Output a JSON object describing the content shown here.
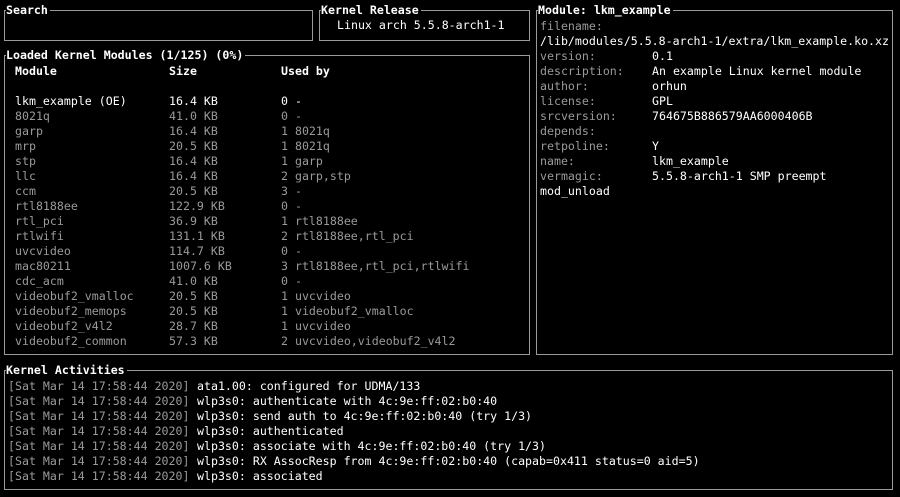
{
  "search": {
    "title": "Search",
    "value": ""
  },
  "kernel_release": {
    "title": "Kernel Release",
    "value": "Linux arch 5.5.8-arch1-1"
  },
  "modules": {
    "title": "Loaded Kernel Modules (1/125) (0%)",
    "columns": [
      "Module",
      "Size",
      "Used by"
    ],
    "rows": [
      {
        "name": "lkm_example (OE)",
        "size": "16.4 KB",
        "used": "0 -"
      },
      {
        "name": "8021q",
        "size": "41.0 KB",
        "used": "0 -"
      },
      {
        "name": "garp",
        "size": "16.4 KB",
        "used": "1 8021q"
      },
      {
        "name": "mrp",
        "size": "20.5 KB",
        "used": "1 8021q"
      },
      {
        "name": "stp",
        "size": "16.4 KB",
        "used": "1 garp"
      },
      {
        "name": "llc",
        "size": "16.4 KB",
        "used": "2 garp,stp"
      },
      {
        "name": "ccm",
        "size": "20.5 KB",
        "used": "3 -"
      },
      {
        "name": "rtl8188ee",
        "size": "122.9 KB",
        "used": "0 -"
      },
      {
        "name": "rtl_pci",
        "size": "36.9 KB",
        "used": "1 rtl8188ee"
      },
      {
        "name": "rtlwifi",
        "size": "131.1 KB",
        "used": "2 rtl8188ee,rtl_pci"
      },
      {
        "name": "uvcvideo",
        "size": "114.7 KB",
        "used": "0 -"
      },
      {
        "name": "mac80211",
        "size": "1007.6 KB",
        "used": "3 rtl8188ee,rtl_pci,rtlwifi"
      },
      {
        "name": "cdc_acm",
        "size": "41.0 KB",
        "used": "0 -"
      },
      {
        "name": "videobuf2_vmalloc",
        "size": "20.5 KB",
        "used": "1 uvcvideo"
      },
      {
        "name": "videobuf2_memops",
        "size": "20.5 KB",
        "used": "1 videobuf2_vmalloc"
      },
      {
        "name": "videobuf2_v4l2",
        "size": "28.7 KB",
        "used": "1 uvcvideo"
      },
      {
        "name": "videobuf2_common",
        "size": "57.3 KB",
        "used": "2 uvcvideo,videobuf2_v4l2"
      }
    ]
  },
  "module_info": {
    "title": "Module: lkm_example",
    "filename_label": "filename:",
    "filename_value": "/lib/modules/5.5.8-arch1-1/extra/lkm_example.ko.xz",
    "fields": [
      {
        "label": "version:",
        "value": "0.1"
      },
      {
        "label": "description:",
        "value": "An example Linux kernel module"
      },
      {
        "label": "author:",
        "value": "orhun"
      },
      {
        "label": "license:",
        "value": "GPL"
      },
      {
        "label": "srcversion:",
        "value": "764675B886579AA6000406B"
      },
      {
        "label": "depends:",
        "value": ""
      },
      {
        "label": "retpoline:",
        "value": "Y"
      },
      {
        "label": "name:",
        "value": "lkm_example"
      },
      {
        "label": "vermagic:",
        "value": "5.5.8-arch1-1 SMP preempt"
      }
    ],
    "trailer": "mod_unload"
  },
  "activities": {
    "title": "Kernel Activities",
    "entries": [
      {
        "time": "[Sat Mar 14 17:58:44 2020]",
        "msg": "ata1.00: configured for UDMA/133"
      },
      {
        "time": "[Sat Mar 14 17:58:44 2020]",
        "msg": "wlp3s0: authenticate with 4c:9e:ff:02:b0:40"
      },
      {
        "time": "[Sat Mar 14 17:58:44 2020]",
        "msg": "wlp3s0: send auth to 4c:9e:ff:02:b0:40 (try 1/3)"
      },
      {
        "time": "[Sat Mar 14 17:58:44 2020]",
        "msg": "wlp3s0: authenticated"
      },
      {
        "time": "[Sat Mar 14 17:58:44 2020]",
        "msg": "wlp3s0: associate with 4c:9e:ff:02:b0:40 (try 1/3)"
      },
      {
        "time": "[Sat Mar 14 17:58:44 2020]",
        "msg": "wlp3s0: RX AssocResp from 4c:9e:ff:02:b0:40 (capab=0x411 status=0 aid=5)"
      },
      {
        "time": "[Sat Mar 14 17:58:44 2020]",
        "msg": "wlp3s0: associated"
      }
    ]
  },
  "colors": {
    "border": "#9a9a9a",
    "dim_text": "#9a9a9a",
    "bright_text": "#ffffff",
    "background": "#000000"
  }
}
